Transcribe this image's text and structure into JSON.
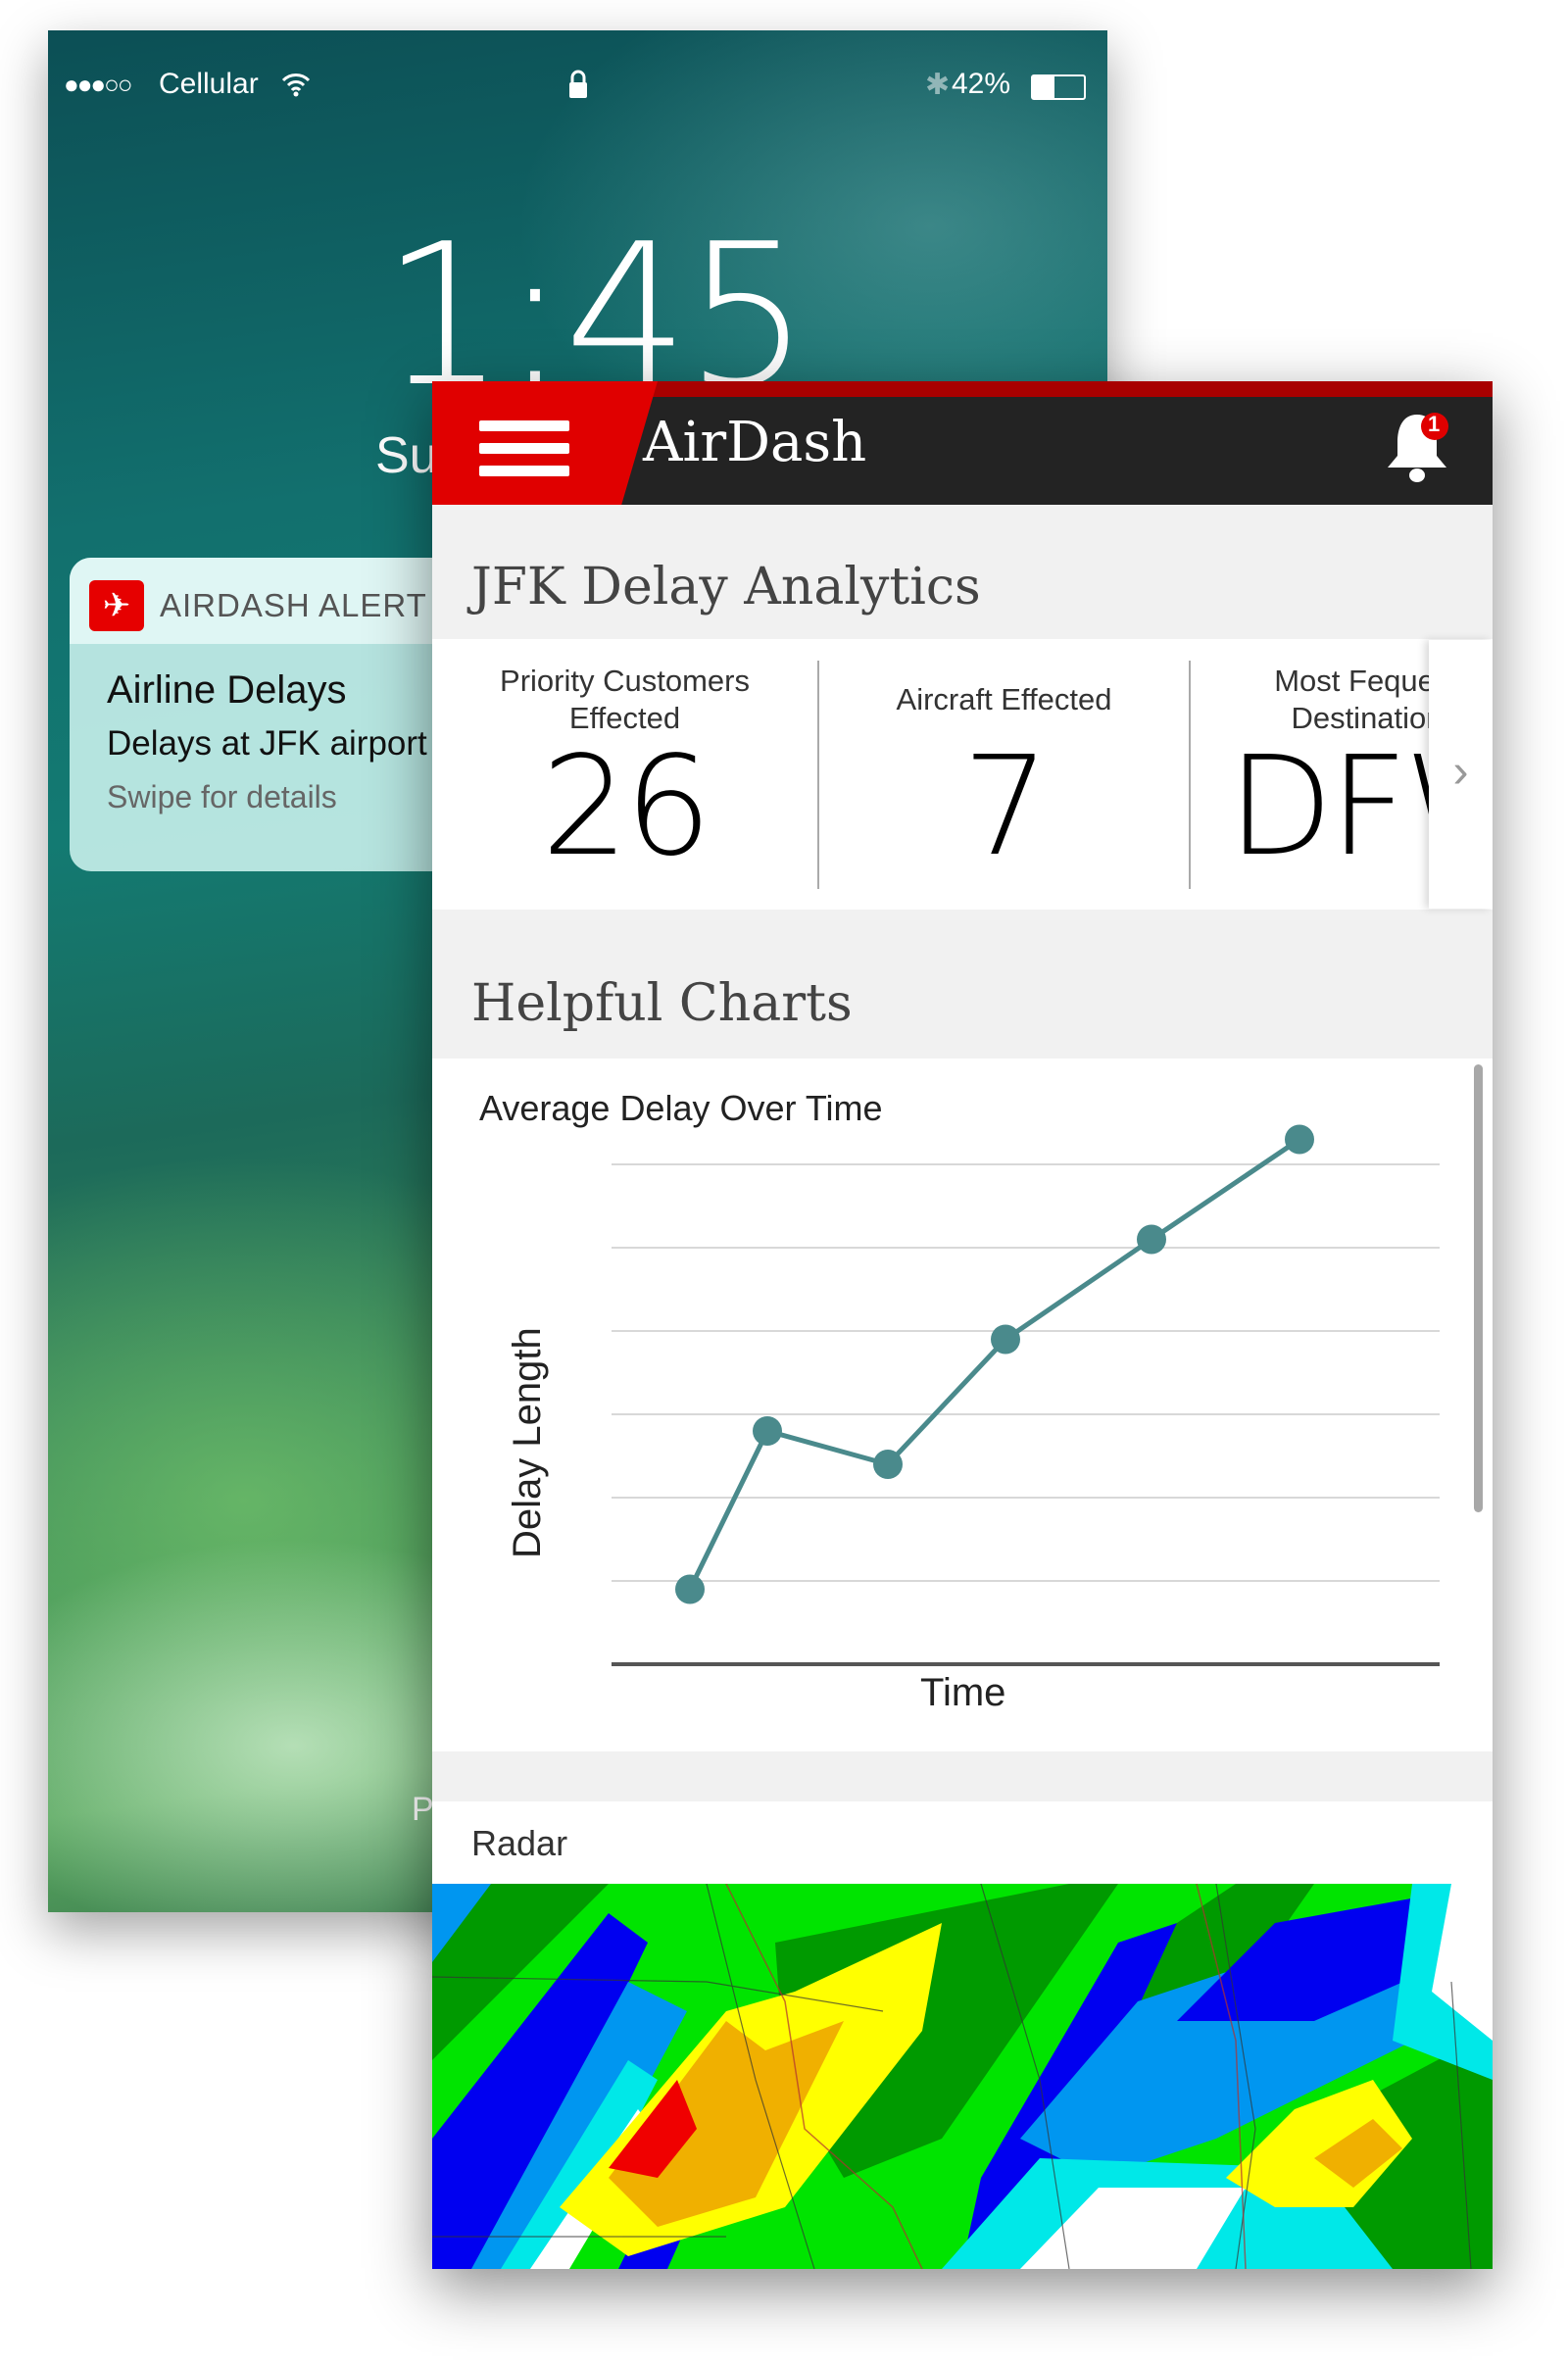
{
  "lock_screen": {
    "status_bar": {
      "signal": "●●●○○",
      "carrier": "Cellular",
      "battery": "42%",
      "battery_level": 0.42
    },
    "time": "1:45",
    "date_partial": "Su",
    "unlock_hint_partial": "P",
    "notification": {
      "app": "AIRDASH ALERT",
      "title": "Airline Delays",
      "body": "Delays at JFK airport",
      "hint": "Swipe for details",
      "icon": "airplane-icon",
      "icon_color": "#e60000"
    }
  },
  "app": {
    "title": "AirDash",
    "brand_color": "#e00000",
    "header_color": "#232323",
    "notification_count": "1",
    "section_title": "JFK Delay Analytics",
    "stats": [
      {
        "label": "Priority Customers\nEffected",
        "value": "26"
      },
      {
        "label": "Aircraft Effected",
        "value": "7"
      },
      {
        "label": "Most Fequent\nDestination",
        "value": "DFW"
      }
    ],
    "charts_title": "Helpful Charts",
    "radar_title": "Radar"
  },
  "chart_data": {
    "type": "line",
    "title": "Average Delay Over Time",
    "xlabel": "Time",
    "ylabel": "Delay Length",
    "x": [
      1,
      2,
      3,
      4,
      5,
      6
    ],
    "values": [
      0.9,
      2.8,
      2.4,
      3.9,
      5.1,
      6.3
    ],
    "ylim": [
      0,
      6.6
    ],
    "grid": true,
    "color": "#4a8a8c"
  }
}
